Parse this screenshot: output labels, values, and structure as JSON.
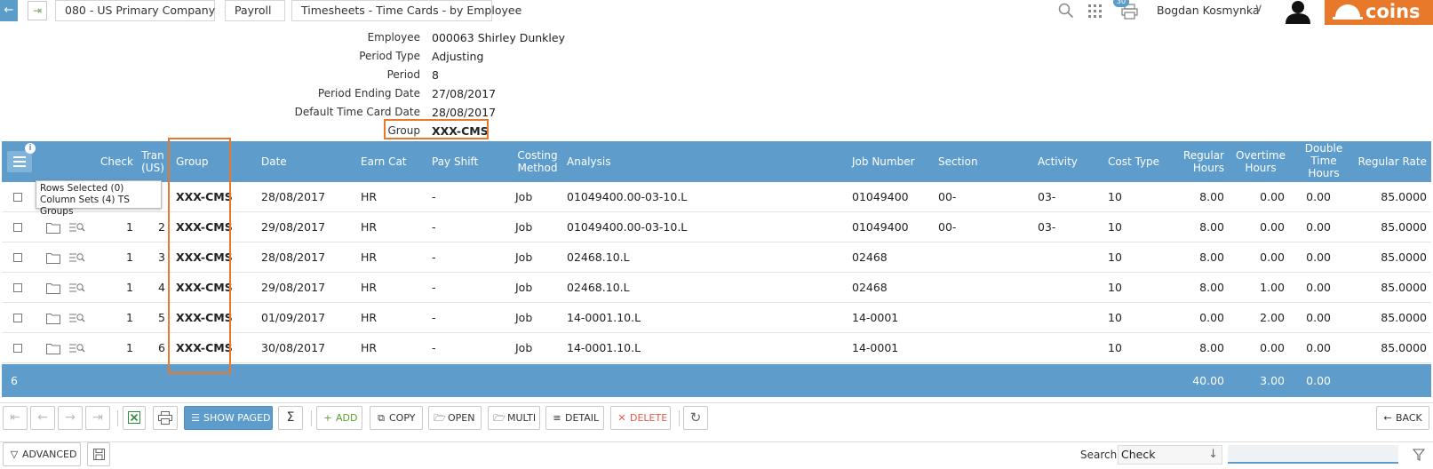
{
  "breadcrumb": {
    "company": "080 - US Primary Company",
    "module": "Payroll",
    "page": "Timesheets - Time Cards - by Employee"
  },
  "header": {
    "notification_count": "30",
    "user_name": "Bogdan Kosmynka",
    "logo_text": "coins"
  },
  "fields": [
    {
      "label": "Employee",
      "value": "000063 Shirley Dunkley"
    },
    {
      "label": "Period Type",
      "value": "Adjusting"
    },
    {
      "label": "Period",
      "value": "8"
    },
    {
      "label": "Period Ending Date",
      "value": "27/08/2017"
    },
    {
      "label": "Default Time Card Date",
      "value": "28/08/2017"
    },
    {
      "label": "Group",
      "value": "XXX-CMS"
    }
  ],
  "grid": {
    "columns": {
      "check": "Check",
      "tran": "Tran (US)",
      "group": "Group",
      "date": "Date",
      "earn_cat": "Earn Cat",
      "pay_shift": "Pay Shift",
      "costing_method": "Costing Method",
      "analysis": "Analysis",
      "job_number": "Job Number",
      "section": "Section",
      "activity": "Activity",
      "cost_type": "Cost Type",
      "regular_hours": "Regular Hours",
      "overtime_hours": "Overtime Hours",
      "double_time_hours": "Double Time Hours",
      "regular_rate": "Regular Rate"
    },
    "rows": [
      {
        "check": "",
        "tran": "",
        "group": "XXX-CMS",
        "date": "28/08/2017",
        "earn_cat": "HR",
        "pay_shift": "-",
        "costing_method": "Job",
        "analysis": "01049400.00-03-10.L",
        "job_number": "01049400",
        "section": "00-",
        "activity": "03-",
        "cost_type": "10",
        "regular_hours": "8.00",
        "overtime_hours": "0.00",
        "double_time_hours": "0.00",
        "regular_rate": "85.0000"
      },
      {
        "check": "1",
        "tran": "2",
        "group": "XXX-CMS",
        "date": "29/08/2017",
        "earn_cat": "HR",
        "pay_shift": "-",
        "costing_method": "Job",
        "analysis": "01049400.00-03-10.L",
        "job_number": "01049400",
        "section": "00-",
        "activity": "03-",
        "cost_type": "10",
        "regular_hours": "8.00",
        "overtime_hours": "0.00",
        "double_time_hours": "0.00",
        "regular_rate": "85.0000"
      },
      {
        "check": "1",
        "tran": "3",
        "group": "XXX-CMS",
        "date": "28/08/2017",
        "earn_cat": "HR",
        "pay_shift": "-",
        "costing_method": "Job",
        "analysis": "02468.10.L",
        "job_number": "02468",
        "section": "",
        "activity": "",
        "cost_type": "10",
        "regular_hours": "8.00",
        "overtime_hours": "0.00",
        "double_time_hours": "0.00",
        "regular_rate": "85.0000"
      },
      {
        "check": "1",
        "tran": "4",
        "group": "XXX-CMS",
        "date": "29/08/2017",
        "earn_cat": "HR",
        "pay_shift": "-",
        "costing_method": "Job",
        "analysis": "02468.10.L",
        "job_number": "02468",
        "section": "",
        "activity": "",
        "cost_type": "10",
        "regular_hours": "8.00",
        "overtime_hours": "1.00",
        "double_time_hours": "0.00",
        "regular_rate": "85.0000"
      },
      {
        "check": "1",
        "tran": "5",
        "group": "XXX-CMS",
        "date": "01/09/2017",
        "earn_cat": "HR",
        "pay_shift": "-",
        "costing_method": "Job",
        "analysis": "14-0001.10.L",
        "job_number": "14-0001",
        "section": "",
        "activity": "",
        "cost_type": "10",
        "regular_hours": "0.00",
        "overtime_hours": "2.00",
        "double_time_hours": "0.00",
        "regular_rate": "85.0000"
      },
      {
        "check": "1",
        "tran": "6",
        "group": "XXX-CMS",
        "date": "30/08/2017",
        "earn_cat": "HR",
        "pay_shift": "-",
        "costing_method": "Job",
        "analysis": "14-0001.10.L",
        "job_number": "14-0001",
        "section": "",
        "activity": "",
        "cost_type": "10",
        "regular_hours": "8.00",
        "overtime_hours": "0.00",
        "double_time_hours": "0.00",
        "regular_rate": "85.0000"
      }
    ],
    "tooltip": {
      "rows_selected": "Rows Selected (0)",
      "column_sets": "Column Sets (4) TS Groups"
    },
    "footer": {
      "count": "6",
      "regular_hours": "40.00",
      "overtime_hours": "3.00",
      "double_time_hours": "0.00"
    }
  },
  "toolbar": {
    "show_paged": "SHOW PAGED",
    "add": "ADD",
    "copy": "COPY",
    "open": "OPEN",
    "multi": "MULTI",
    "detail": "DETAIL",
    "delete": "DELETE",
    "back": "BACK"
  },
  "bottom": {
    "advanced": "ADVANCED",
    "search_label": "Search",
    "search_field": "Check",
    "search_value": ""
  },
  "colors": {
    "accent_blue": "#5d9ccb",
    "highlight_orange": "#e8792b",
    "delete_red": "#e05b4b",
    "excel_green": "#2e8b3c"
  }
}
